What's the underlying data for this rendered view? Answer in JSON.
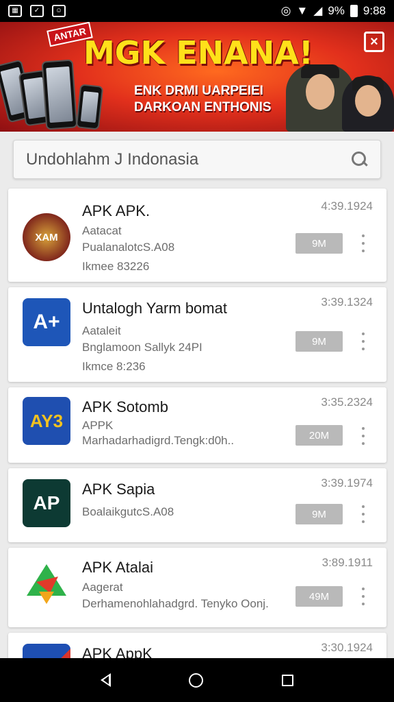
{
  "status_bar": {
    "battery": "9%",
    "time": "9:88"
  },
  "banner": {
    "ribbon": "ANTAR",
    "headline": "MGK ENANA!",
    "subline1": "ENK DRMI UARPEIEI",
    "subline2": "DARKOAN ENTHONIS"
  },
  "search": {
    "placeholder": "Undohlahm J Indonasia"
  },
  "apps": [
    {
      "name": "APK APK.",
      "line1": "Aatacat",
      "line2": "PualanalotcS.A08",
      "line3": "Ikmee 83226",
      "date": "4:39.1924",
      "size": "9M",
      "icon_label": "XAM",
      "icon_colors": [
        "#7a1f1a",
        "#d7a23a"
      ]
    },
    {
      "name": "Untalogh Yarm bomat",
      "line1": "Aataleit",
      "line2": "Bnglamoon Sallyk 24PI",
      "line3": "Ikmce 8:236",
      "date": "3:39.1324",
      "size": "9M",
      "icon_label": "A+",
      "icon_colors": [
        "#1e56b8",
        "#ffffff"
      ]
    },
    {
      "name": "APK Sotomb",
      "line1": "APPK",
      "line2": "Marhadarhadigrd.Tengk:d0h..",
      "line3": "",
      "date": "3:35.2324",
      "size": "20M",
      "icon_label": "AY3",
      "icon_colors": [
        "#1f4fb0",
        "#f4c21f"
      ]
    },
    {
      "name": "APK Sapia",
      "line1": "BoalaikgutcS.A08",
      "line2": "",
      "line3": "",
      "date": "3:39.1974",
      "size": "9M",
      "icon_label": "AP",
      "icon_colors": [
        "#0d3a33",
        "#ffffff"
      ]
    },
    {
      "name": "APK Atalai",
      "line1": "Aagerat",
      "line2": "Derhamenohlahadgrd. Tenyko Oonj.",
      "line3": "",
      "date": "3:89.1911",
      "size": "49M",
      "icon_label": "",
      "icon_colors": [
        "#2fb24a",
        "#e23a2a"
      ]
    },
    {
      "name": "APK AppK",
      "line1": "",
      "line2": "",
      "line3": "",
      "date": "3:30.1924",
      "size": "",
      "icon_label": "",
      "icon_colors": [
        "#1e4fb3",
        "#d9342b"
      ]
    }
  ]
}
